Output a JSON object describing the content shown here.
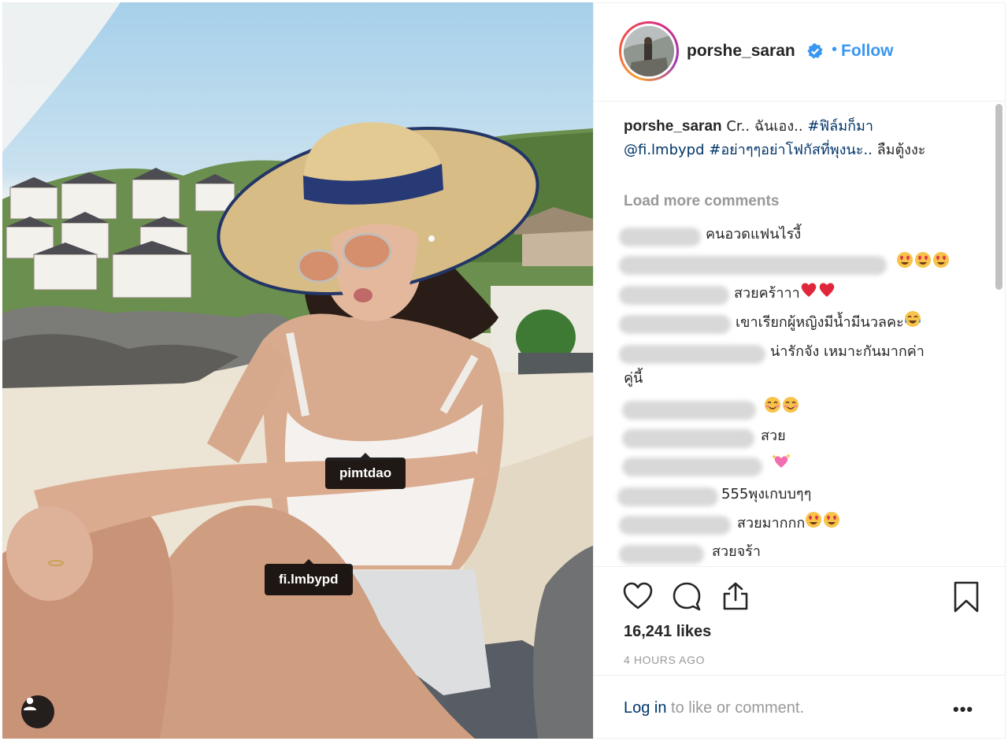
{
  "post": {
    "image_description_icon": "user-tag-icon",
    "tags": [
      {
        "username": "pimtdao"
      },
      {
        "username": "fi.lmbypd"
      }
    ]
  },
  "header": {
    "username": "porshe_saran",
    "verified_icon": "verified-badge-icon",
    "separator": "•",
    "follow_label": "Follow",
    "accent_color": "#3897f0"
  },
  "caption": {
    "username": "porshe_saran",
    "text_part1": "Cr.. ฉันเอง..",
    "hashtag1": "#ฟิล์มก็มา",
    "mention": "@fi.lmbypd",
    "hashtag2": "#อย่าๆๆอย่าโฟกัสที่พุงนะ..",
    "text_part2": "ลืมตู้งงะ"
  },
  "load_more_label": "Load more comments",
  "comments": [
    {
      "text": "คนอวดแฟนไรงี้",
      "emoji": []
    },
    {
      "text": "",
      "emoji": [
        "heart-eyes",
        "heart-eyes",
        "heart-eyes"
      ]
    },
    {
      "text": "สวยคร้าาา",
      "emoji": [
        "red-heart",
        "red-heart"
      ]
    },
    {
      "text": "เขาเรียกผู้หญิงมีน้ำมีนวลคะ",
      "emoji": [
        "tears-of-joy"
      ]
    },
    {
      "text": "น่ารักจัง เหมาะกันมากค่า",
      "text2": "คู่นี้",
      "emoji": []
    },
    {
      "text": "",
      "emoji": [
        "blush",
        "blush"
      ]
    },
    {
      "text": "สวย",
      "emoji": []
    },
    {
      "text": "",
      "emoji": [
        "sparkling-heart"
      ]
    },
    {
      "text": "555พุงเกบบๆๆ",
      "emoji": []
    },
    {
      "text": "สวยมากกก",
      "emoji": [
        "heart-eyes",
        "heart-eyes"
      ]
    },
    {
      "text": "สวยจร้า",
      "emoji": []
    }
  ],
  "actions": {
    "like_icon": "heart-icon",
    "comment_icon": "comment-icon",
    "share_icon": "share-icon",
    "save_icon": "bookmark-icon",
    "likes": "16,241 likes",
    "timestamp": "4 HOURS AGO"
  },
  "footer": {
    "login_link": "Log in",
    "login_rest": " to like or comment.",
    "more_label": "•••"
  }
}
